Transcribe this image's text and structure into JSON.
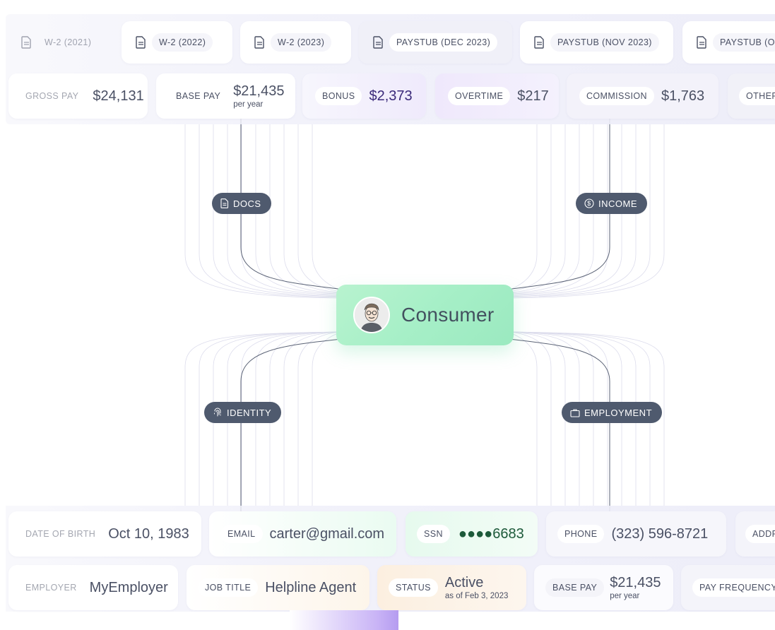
{
  "documents": [
    {
      "label": "W-2 (2021)",
      "dim": true
    },
    {
      "label": "W-2 (2022)",
      "dim": false
    },
    {
      "label": "W-2 (2023)",
      "dim": false
    },
    {
      "label": "PAYSTUB  (DEC 2023)",
      "dim": false
    },
    {
      "label": "PAYSTUB  (NOV 2023)",
      "dim": false
    },
    {
      "label": "PAYSTUB  (O",
      "dim": false
    }
  ],
  "income": {
    "gross_pay": {
      "label": "GROSS PAY",
      "value": "$24,131"
    },
    "base_pay": {
      "label": "BASE PAY",
      "value": "$21,435",
      "sub": "per year"
    },
    "bonus": {
      "label": "BONUS",
      "value": "$2,373"
    },
    "overtime": {
      "label": "OVERTIME",
      "value": "$217"
    },
    "commission": {
      "label": "COMMISSION",
      "value": "$1,763"
    },
    "other": {
      "label": "OTHER"
    }
  },
  "nodes": {
    "docs": "DOCS",
    "income": "INCOME",
    "identity": "IDENTITY",
    "employment": "EMPLOYMENT",
    "consumer": "Consumer"
  },
  "identity": {
    "dob": {
      "label": "DATE OF BIRTH",
      "value": "Oct 10, 1983"
    },
    "email": {
      "label": "EMAIL",
      "value": "carter@gmail.com"
    },
    "ssn": {
      "label": "SSN",
      "value": "●●●●6683"
    },
    "phone": {
      "label": "PHONE",
      "value": "(323) 596-8721"
    },
    "address": {
      "label": "ADDR"
    }
  },
  "employment": {
    "employer": {
      "label": "EMPLOYER",
      "value": "MyEmployer"
    },
    "job_title": {
      "label": "JOB TITLE",
      "value": "Helpline Agent"
    },
    "status": {
      "label": "STATUS",
      "value": "Active",
      "sub": "as of Feb 3, 2023"
    },
    "base_pay": {
      "label": "BASE PAY",
      "value": "$21,435",
      "sub": "per year"
    },
    "pay_frequency": {
      "label": "PAY FREQUENCY"
    }
  },
  "colors": {
    "node_pill": "#4f5a6e",
    "consumer_green": "#a6efc7",
    "bonus_purple": "#3b2a7a",
    "ssn_green": "#1d5a3a"
  }
}
